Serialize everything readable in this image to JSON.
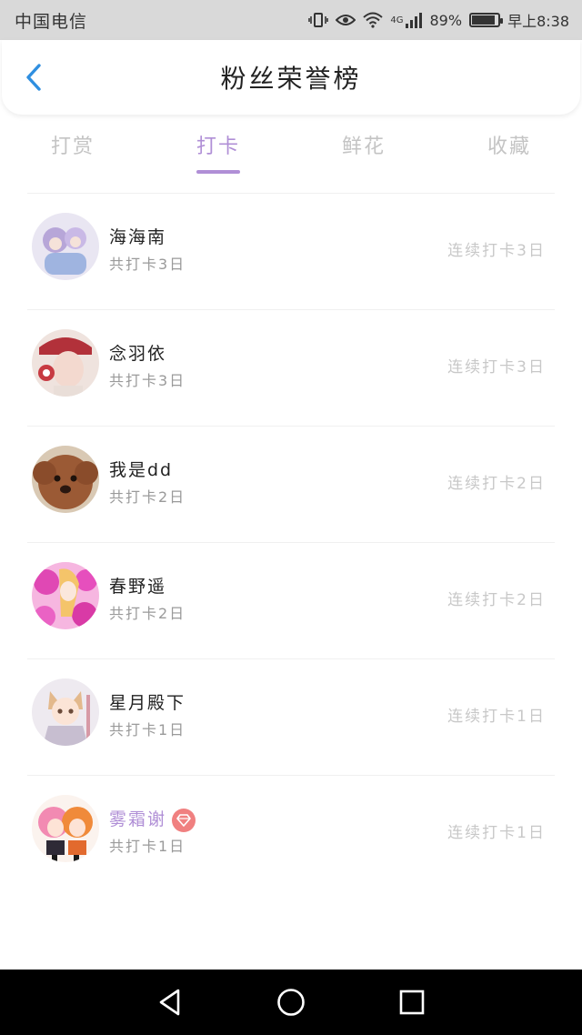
{
  "status_bar": {
    "carrier": "中国电信",
    "network": "4G",
    "battery_percent": "89%",
    "battery_level": 0.89,
    "time": "早上8:38"
  },
  "header": {
    "title": "粉丝荣誉榜",
    "back_icon": "chevron-left-icon"
  },
  "tabs": [
    {
      "label": "打赏",
      "active": false
    },
    {
      "label": "打卡",
      "active": true
    },
    {
      "label": "鲜花",
      "active": false
    },
    {
      "label": "收藏",
      "active": false
    }
  ],
  "fans": [
    {
      "name": "海海南",
      "total": "共打卡3日",
      "streak": "连续打卡3日",
      "vip": false
    },
    {
      "name": "念羽依",
      "total": "共打卡3日",
      "streak": "连续打卡3日",
      "vip": false
    },
    {
      "name": "我是dd",
      "total": "共打卡2日",
      "streak": "连续打卡2日",
      "vip": false
    },
    {
      "name": "春野遥",
      "total": "共打卡2日",
      "streak": "连续打卡2日",
      "vip": false
    },
    {
      "name": "星月殿下",
      "total": "共打卡1日",
      "streak": "连续打卡1日",
      "vip": false
    },
    {
      "name": "雾霜谢",
      "total": "共打卡1日",
      "streak": "连续打卡1日",
      "vip": true
    }
  ],
  "colors": {
    "accent": "#b08fd6",
    "vip_badge": "#f08080",
    "back_arrow": "#2f8fe0"
  },
  "nav": [
    "back-triangle-icon",
    "home-circle-icon",
    "recents-square-icon"
  ]
}
